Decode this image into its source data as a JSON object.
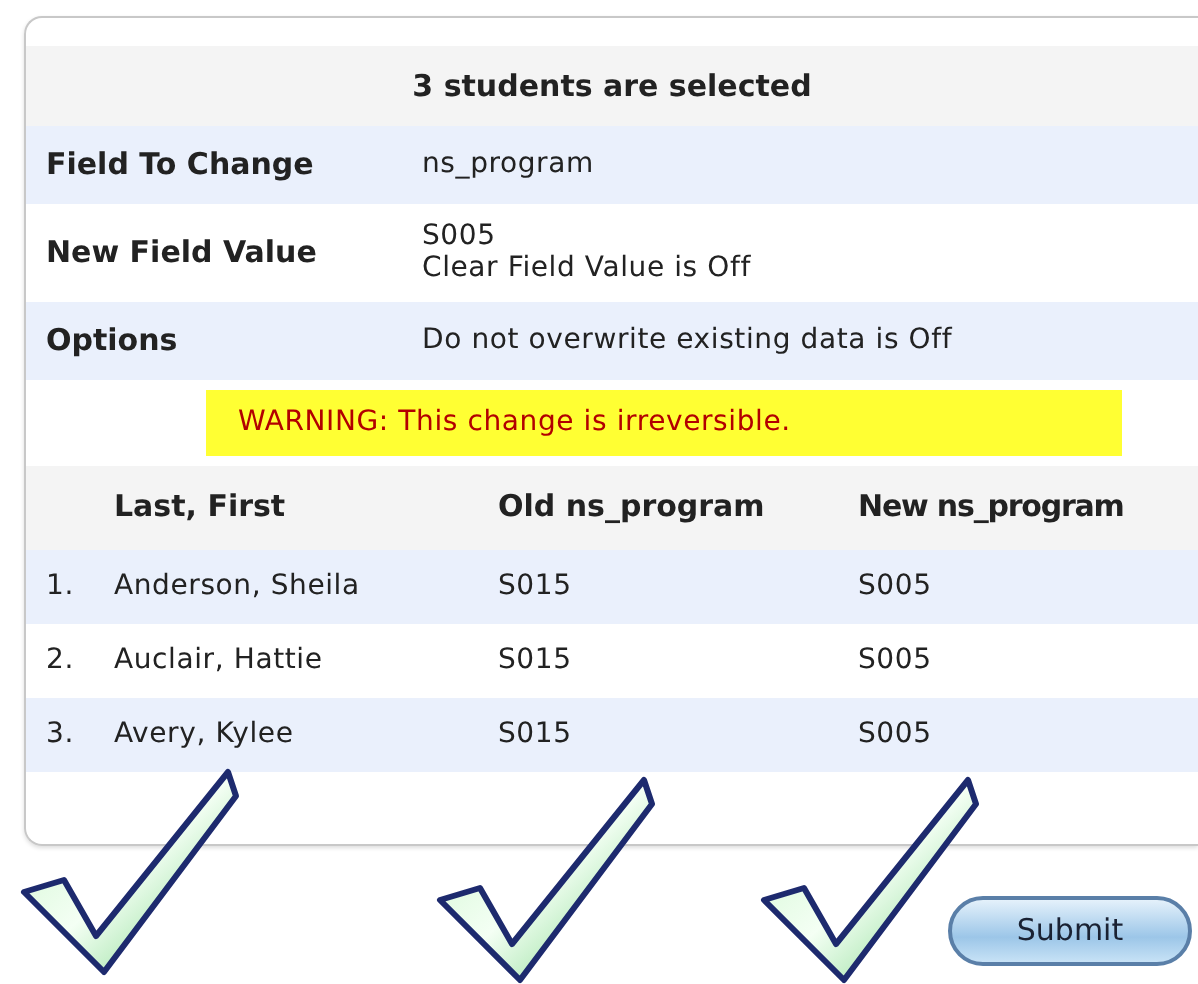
{
  "panel": {
    "title": "3 students are selected",
    "fields": [
      {
        "label": "Field To Change",
        "lines": [
          "ns_program"
        ]
      },
      {
        "label": "New Field Value",
        "lines": [
          "S005",
          "Clear Field Value is Off"
        ]
      },
      {
        "label": "Options",
        "lines": [
          "Do not overwrite existing data is Off"
        ]
      }
    ],
    "warning": "WARNING: This change is irreversible.",
    "table": {
      "columns": [
        "Last, First",
        "Old ns_program",
        "New ns_program"
      ],
      "rows": [
        {
          "number": "1.",
          "name": "Anderson, Sheila",
          "old": "S015",
          "new": "S005"
        },
        {
          "number": "2.",
          "name": "Auclair, Hattie",
          "old": "S015",
          "new": "S005"
        },
        {
          "number": "3.",
          "name": "Avery, Kylee",
          "old": "S015",
          "new": "S005"
        }
      ]
    }
  },
  "submit_button": "Submit"
}
